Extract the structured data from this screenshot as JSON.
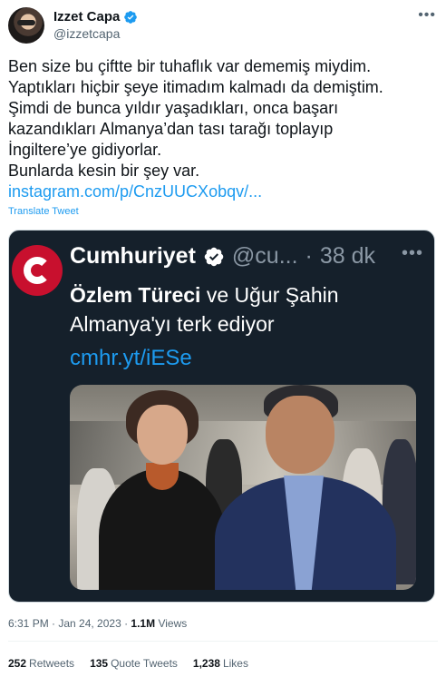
{
  "author": {
    "name": "Izzet Capa",
    "handle": "@izzetcapa"
  },
  "tweet": {
    "lines": [
      "Ben size bu çiftte bir tuhaflık var dememiş miydim.",
      "Yaptıkları hiçbir şeye itimadım kalmadı da demiştim.",
      "Şimdi de bunca yıldır yaşadıkları, onca başarı",
      "kazandıkları Almanya’dan tası tarağı toplayıp",
      "İngiltere’ye gidiyorlar.",
      "Bunlarda kesin bir şey var."
    ],
    "link": "instagram.com/p/CnzUUCXobqv/...",
    "translate": "Translate Tweet"
  },
  "embedded": {
    "name": "Cumhuriyet",
    "handle": "@cu...",
    "time": "38 dk",
    "line1_bold": "Özlem Türeci",
    "line1_rest": " ve Uğur Şahin",
    "line2": "Almanya'yı terk ediyor",
    "link": "cmhr.yt/iESe"
  },
  "meta": {
    "timestamp": "6:31 PM · Jan 24, 2023 · ",
    "views_count": "1.1M",
    "views_label": " Views"
  },
  "stats": {
    "retweets_count": "252",
    "retweets_label": "Retweets",
    "quotes_count": "135",
    "quotes_label": "Quote Tweets",
    "likes_count": "1,238",
    "likes_label": "Likes"
  },
  "colors": {
    "accent": "#1d9bf0",
    "card_bg": "#15202b",
    "logo_red": "#c8102e"
  },
  "icons": [
    "verified-badge-icon",
    "more-options-icon",
    "cumhuriyet-logo"
  ]
}
